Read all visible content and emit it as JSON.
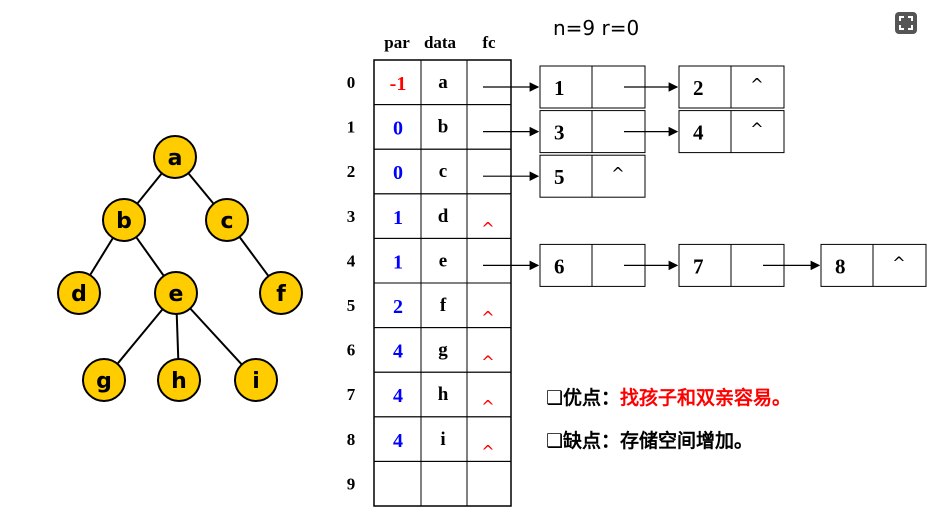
{
  "stats": "n=9  r=0",
  "table": {
    "headers": {
      "par": "par",
      "data": "data",
      "fc": "fc"
    },
    "rows": [
      {
        "index": "0",
        "par": "-1",
        "data": "a",
        "fc": ""
      },
      {
        "index": "1",
        "par": "0",
        "data": "b",
        "fc": ""
      },
      {
        "index": "2",
        "par": "0",
        "data": "c",
        "fc": ""
      },
      {
        "index": "3",
        "par": "1",
        "data": "d",
        "fc": "^"
      },
      {
        "index": "4",
        "par": "1",
        "data": "e",
        "fc": ""
      },
      {
        "index": "5",
        "par": "2",
        "data": "f",
        "fc": "^"
      },
      {
        "index": "6",
        "par": "4",
        "data": "g",
        "fc": "^"
      },
      {
        "index": "7",
        "par": "4",
        "data": "h",
        "fc": "^"
      },
      {
        "index": "8",
        "par": "4",
        "data": "i",
        "fc": "^"
      },
      {
        "index": "9",
        "par": "",
        "data": "",
        "fc": ""
      }
    ]
  },
  "chains": [
    {
      "row": 0,
      "nodes": [
        {
          "value": "1",
          "next": ""
        },
        {
          "value": "2",
          "next": "^"
        }
      ]
    },
    {
      "row": 1,
      "nodes": [
        {
          "value": "3",
          "next": ""
        },
        {
          "value": "4",
          "next": "^"
        }
      ]
    },
    {
      "row": 2,
      "nodes": [
        {
          "value": "5",
          "next": "^"
        }
      ]
    },
    {
      "row": 4,
      "nodes": [
        {
          "value": "6",
          "next": ""
        },
        {
          "value": "7",
          "next": ""
        },
        {
          "value": "8",
          "next": "^"
        }
      ]
    }
  ],
  "tree": {
    "nodes": [
      "a",
      "b",
      "c",
      "d",
      "e",
      "f",
      "g",
      "h",
      "i"
    ],
    "edges": [
      [
        "a",
        "b"
      ],
      [
        "a",
        "c"
      ],
      [
        "b",
        "d"
      ],
      [
        "b",
        "e"
      ],
      [
        "c",
        "f"
      ],
      [
        "e",
        "g"
      ],
      [
        "e",
        "h"
      ],
      [
        "e",
        "i"
      ]
    ]
  },
  "notes": {
    "pros_label": "❑优点：",
    "pros_text": "找孩子和双亲容易。",
    "cons_label": "❑缺点：",
    "cons_text": "存储空间增加。"
  },
  "colors": {
    "node_fill": "#FFCC00",
    "par_negative": "#FF0000",
    "par_positive": "#0000FF",
    "null_marker": "#FF0000",
    "pros_text": "#FF0000",
    "fullscreen_button": "#555555"
  },
  "icons": {
    "fullscreen": "fullscreen-icon"
  }
}
